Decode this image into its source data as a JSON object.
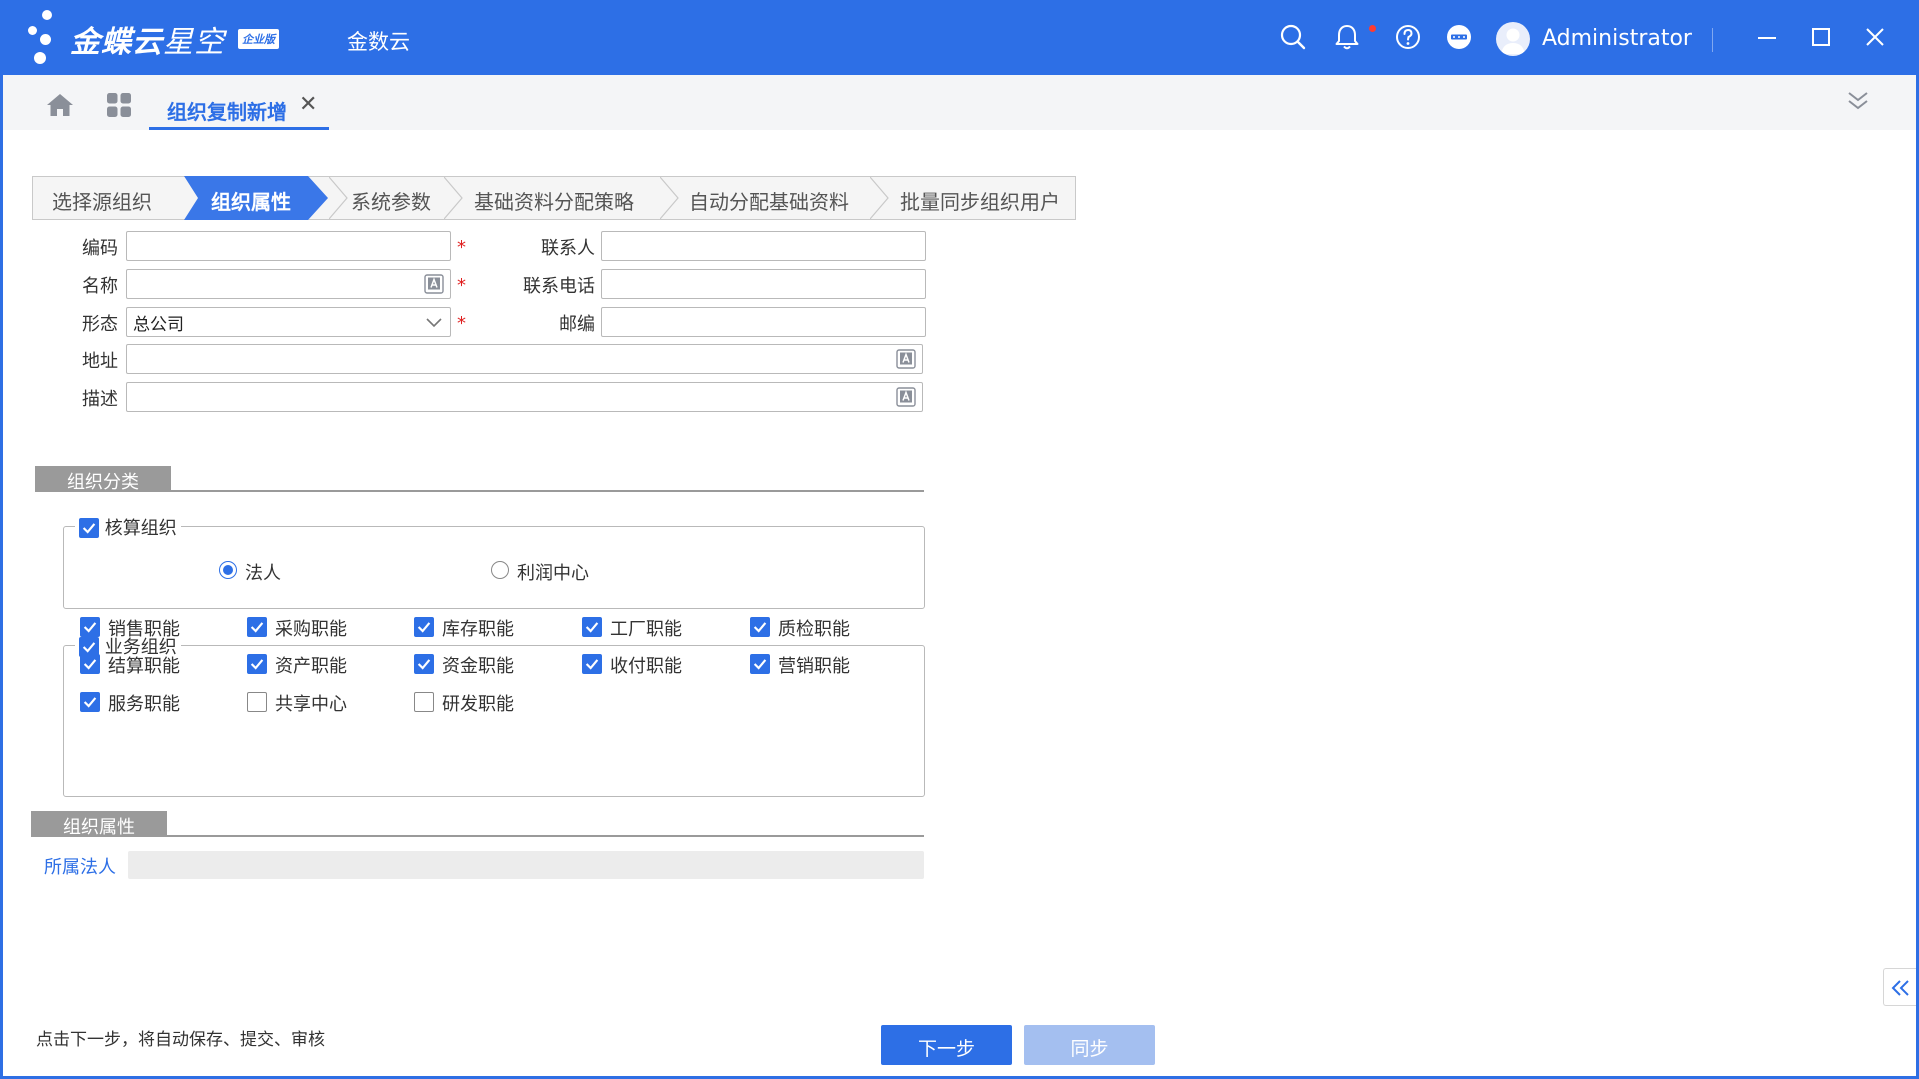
{
  "header": {
    "logo_main": "金蝶云",
    "logo_sub": "星空",
    "logo_badge": "企业版",
    "app_name": "金数云",
    "user": "Administrator",
    "icons": [
      "search-icon",
      "bell-icon",
      "help-icon",
      "minus-circle-icon",
      "avatar",
      "minimize-icon",
      "maximize-icon",
      "close-icon"
    ]
  },
  "tabs": {
    "active_label": "组织复制新增",
    "close_glyph": "✕"
  },
  "steps": [
    "选择源组织",
    "组织属性",
    "系统参数",
    "基础资料分配策略",
    "自动分配基础资料",
    "批量同步组织用户"
  ],
  "steps_active_index": 1,
  "form": {
    "code_label": "编码",
    "code_value": "",
    "name_label": "名称",
    "name_value": "",
    "type_label": "形态",
    "type_value": "总公司",
    "contact_label": "联系人",
    "contact_value": "",
    "phone_label": "联系电话",
    "phone_value": "",
    "zip_label": "邮编",
    "zip_value": "",
    "address_label": "地址",
    "address_value": "",
    "desc_label": "描述",
    "desc_value": "",
    "required_mark": "*"
  },
  "classification": {
    "section_title": "组织分类",
    "accounting": {
      "label": "核算组织",
      "checked": true,
      "radios": [
        {
          "label": "法人",
          "selected": true
        },
        {
          "label": "利润中心",
          "selected": false
        }
      ]
    },
    "business": {
      "label": "业务组织",
      "checked": true,
      "functions": [
        {
          "label": "销售职能",
          "checked": true
        },
        {
          "label": "采购职能",
          "checked": true
        },
        {
          "label": "库存职能",
          "checked": true
        },
        {
          "label": "工厂职能",
          "checked": true
        },
        {
          "label": "质检职能",
          "checked": true
        },
        {
          "label": "结算职能",
          "checked": true
        },
        {
          "label": "资产职能",
          "checked": true
        },
        {
          "label": "资金职能",
          "checked": true
        },
        {
          "label": "收付职能",
          "checked": true
        },
        {
          "label": "营销职能",
          "checked": true
        },
        {
          "label": "服务职能",
          "checked": true
        },
        {
          "label": "共享中心",
          "checked": false
        },
        {
          "label": "研发职能",
          "checked": false
        }
      ]
    }
  },
  "attributes": {
    "section_title": "组织属性",
    "legal_entity_label": "所属法人",
    "legal_entity_value": ""
  },
  "footer": {
    "hint": "点击下一步，将自动保存、提交、审核",
    "next_label": "下一步",
    "sync_label": "同步"
  },
  "colors": {
    "brand": "#2d6fe6",
    "required": "#e02020",
    "section": "#9a9a9a"
  }
}
